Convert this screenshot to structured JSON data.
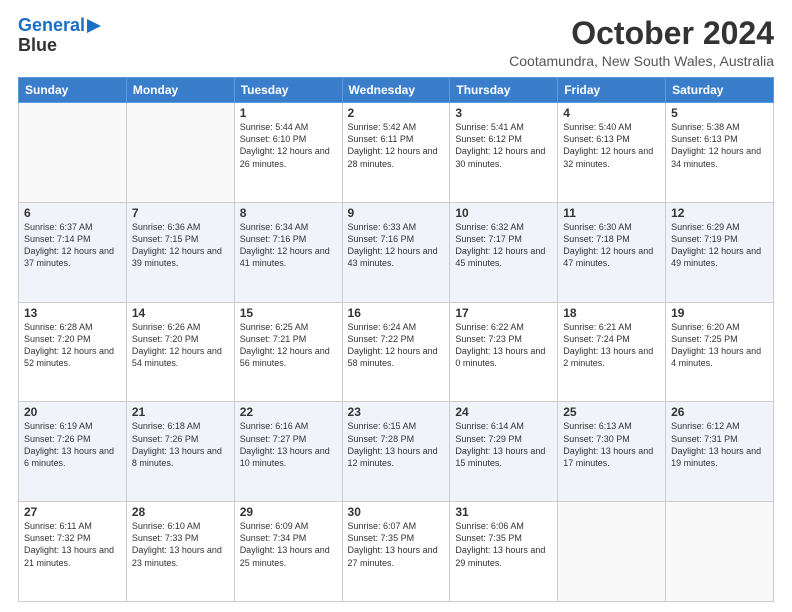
{
  "logo": {
    "line1": "General",
    "line2": "Blue"
  },
  "title": "October 2024",
  "location": "Cootamundra, New South Wales, Australia",
  "days_of_week": [
    "Sunday",
    "Monday",
    "Tuesday",
    "Wednesday",
    "Thursday",
    "Friday",
    "Saturday"
  ],
  "weeks": [
    [
      {
        "day": "",
        "info": ""
      },
      {
        "day": "",
        "info": ""
      },
      {
        "day": "1",
        "info": "Sunrise: 5:44 AM\nSunset: 6:10 PM\nDaylight: 12 hours and 26 minutes."
      },
      {
        "day": "2",
        "info": "Sunrise: 5:42 AM\nSunset: 6:11 PM\nDaylight: 12 hours and 28 minutes."
      },
      {
        "day": "3",
        "info": "Sunrise: 5:41 AM\nSunset: 6:12 PM\nDaylight: 12 hours and 30 minutes."
      },
      {
        "day": "4",
        "info": "Sunrise: 5:40 AM\nSunset: 6:13 PM\nDaylight: 12 hours and 32 minutes."
      },
      {
        "day": "5",
        "info": "Sunrise: 5:38 AM\nSunset: 6:13 PM\nDaylight: 12 hours and 34 minutes."
      }
    ],
    [
      {
        "day": "6",
        "info": "Sunrise: 6:37 AM\nSunset: 7:14 PM\nDaylight: 12 hours and 37 minutes."
      },
      {
        "day": "7",
        "info": "Sunrise: 6:36 AM\nSunset: 7:15 PM\nDaylight: 12 hours and 39 minutes."
      },
      {
        "day": "8",
        "info": "Sunrise: 6:34 AM\nSunset: 7:16 PM\nDaylight: 12 hours and 41 minutes."
      },
      {
        "day": "9",
        "info": "Sunrise: 6:33 AM\nSunset: 7:16 PM\nDaylight: 12 hours and 43 minutes."
      },
      {
        "day": "10",
        "info": "Sunrise: 6:32 AM\nSunset: 7:17 PM\nDaylight: 12 hours and 45 minutes."
      },
      {
        "day": "11",
        "info": "Sunrise: 6:30 AM\nSunset: 7:18 PM\nDaylight: 12 hours and 47 minutes."
      },
      {
        "day": "12",
        "info": "Sunrise: 6:29 AM\nSunset: 7:19 PM\nDaylight: 12 hours and 49 minutes."
      }
    ],
    [
      {
        "day": "13",
        "info": "Sunrise: 6:28 AM\nSunset: 7:20 PM\nDaylight: 12 hours and 52 minutes."
      },
      {
        "day": "14",
        "info": "Sunrise: 6:26 AM\nSunset: 7:20 PM\nDaylight: 12 hours and 54 minutes."
      },
      {
        "day": "15",
        "info": "Sunrise: 6:25 AM\nSunset: 7:21 PM\nDaylight: 12 hours and 56 minutes."
      },
      {
        "day": "16",
        "info": "Sunrise: 6:24 AM\nSunset: 7:22 PM\nDaylight: 12 hours and 58 minutes."
      },
      {
        "day": "17",
        "info": "Sunrise: 6:22 AM\nSunset: 7:23 PM\nDaylight: 13 hours and 0 minutes."
      },
      {
        "day": "18",
        "info": "Sunrise: 6:21 AM\nSunset: 7:24 PM\nDaylight: 13 hours and 2 minutes."
      },
      {
        "day": "19",
        "info": "Sunrise: 6:20 AM\nSunset: 7:25 PM\nDaylight: 13 hours and 4 minutes."
      }
    ],
    [
      {
        "day": "20",
        "info": "Sunrise: 6:19 AM\nSunset: 7:26 PM\nDaylight: 13 hours and 6 minutes."
      },
      {
        "day": "21",
        "info": "Sunrise: 6:18 AM\nSunset: 7:26 PM\nDaylight: 13 hours and 8 minutes."
      },
      {
        "day": "22",
        "info": "Sunrise: 6:16 AM\nSunset: 7:27 PM\nDaylight: 13 hours and 10 minutes."
      },
      {
        "day": "23",
        "info": "Sunrise: 6:15 AM\nSunset: 7:28 PM\nDaylight: 13 hours and 12 minutes."
      },
      {
        "day": "24",
        "info": "Sunrise: 6:14 AM\nSunset: 7:29 PM\nDaylight: 13 hours and 15 minutes."
      },
      {
        "day": "25",
        "info": "Sunrise: 6:13 AM\nSunset: 7:30 PM\nDaylight: 13 hours and 17 minutes."
      },
      {
        "day": "26",
        "info": "Sunrise: 6:12 AM\nSunset: 7:31 PM\nDaylight: 13 hours and 19 minutes."
      }
    ],
    [
      {
        "day": "27",
        "info": "Sunrise: 6:11 AM\nSunset: 7:32 PM\nDaylight: 13 hours and 21 minutes."
      },
      {
        "day": "28",
        "info": "Sunrise: 6:10 AM\nSunset: 7:33 PM\nDaylight: 13 hours and 23 minutes."
      },
      {
        "day": "29",
        "info": "Sunrise: 6:09 AM\nSunset: 7:34 PM\nDaylight: 13 hours and 25 minutes."
      },
      {
        "day": "30",
        "info": "Sunrise: 6:07 AM\nSunset: 7:35 PM\nDaylight: 13 hours and 27 minutes."
      },
      {
        "day": "31",
        "info": "Sunrise: 6:06 AM\nSunset: 7:35 PM\nDaylight: 13 hours and 29 minutes."
      },
      {
        "day": "",
        "info": ""
      },
      {
        "day": "",
        "info": ""
      }
    ]
  ]
}
